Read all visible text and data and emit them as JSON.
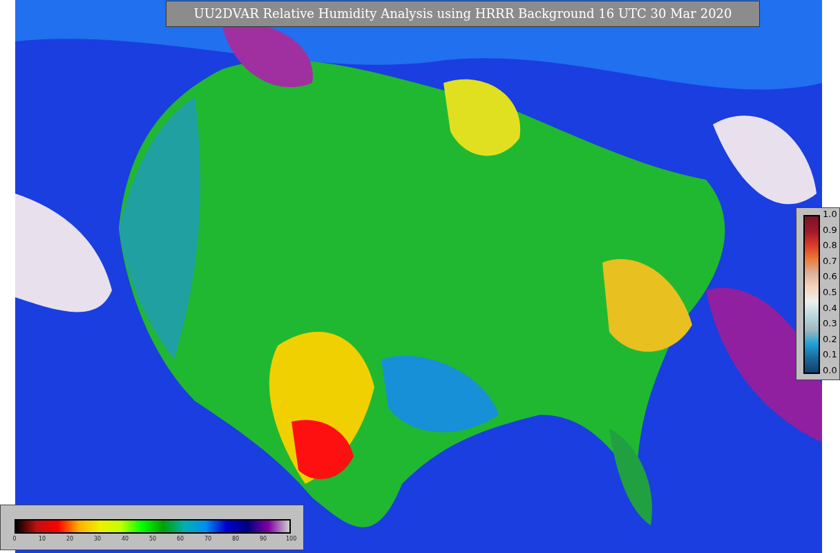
{
  "title": "UU2DVAR Relative Humidity Analysis using HRRR Background 16 UTC 30 Mar 2020",
  "error_colorbar": {
    "ticks": [
      "1.0",
      "0.9",
      "0.8",
      "0.7",
      "0.6",
      "0.5",
      "0.4",
      "0.3",
      "0.2",
      "0.1",
      "0.0"
    ]
  },
  "humidity_colorbar": {
    "ticks": [
      "0",
      "10",
      "20",
      "30",
      "40",
      "50",
      "60",
      "70",
      "80",
      "90",
      "100"
    ]
  }
}
